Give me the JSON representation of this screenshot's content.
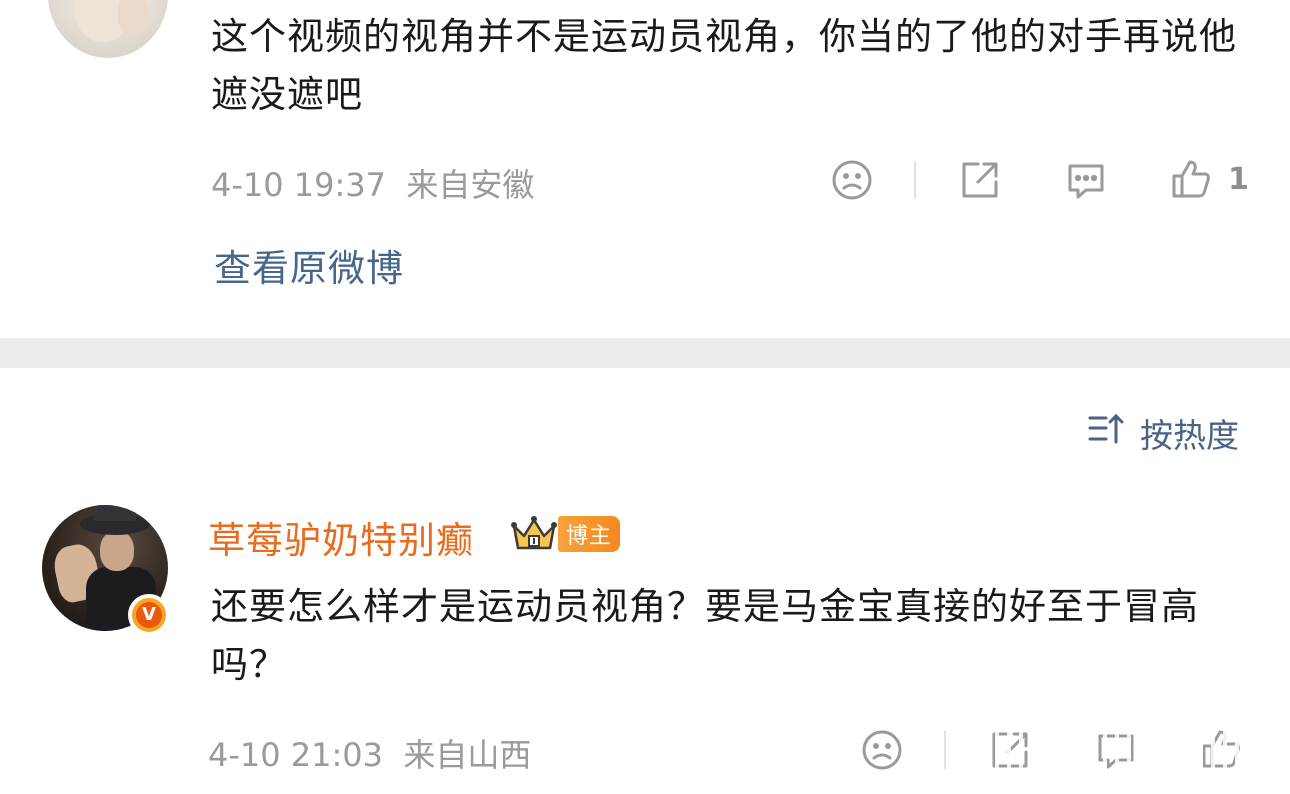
{
  "first_comment": {
    "text": "这个视频的视角并不是运动员视角，你当的了他的对手再说他遮没遮吧",
    "timestamp": "4-10 19:37",
    "location": "来自安徽",
    "like_count": "1",
    "view_original_label": "查看原微博"
  },
  "sort": {
    "label": "按热度"
  },
  "second_comment": {
    "username": "草莓驴奶特别癫",
    "badge_label": "博主",
    "verified_mark": "V",
    "text": "还要怎么样才是运动员视角？要是马金宝真接的好至于冒高吗？",
    "timestamp": "4-10 21:03",
    "location": "来自山西"
  },
  "colors": {
    "username": "#e86b1e",
    "link": "#46668f",
    "meta": "#9a9a9a",
    "badge": "#f5881f"
  },
  "icons": [
    "dislike-face-icon",
    "share-icon",
    "comment-icon",
    "thumbs-up-icon",
    "sort-icon",
    "crown-icon",
    "verified-icon"
  ]
}
